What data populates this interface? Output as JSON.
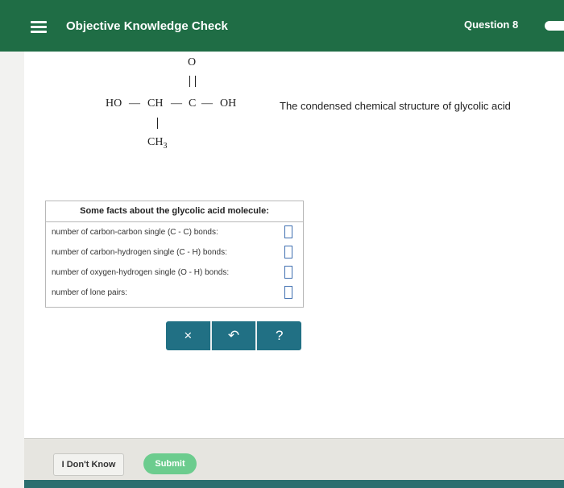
{
  "header": {
    "title": "Objective Knowledge Check",
    "question_label": "Question 8"
  },
  "structure": {
    "o_label": "O",
    "ho_label": "HO",
    "bond_text": "—",
    "ch_label": "CH",
    "c_label": "C",
    "oh_label": "OH",
    "ch3_label": "CH",
    "ch3_sub": "3",
    "caption": "The condensed chemical structure of glycolic acid"
  },
  "facts": {
    "title": "Some facts about the glycolic acid molecule:",
    "rows": [
      {
        "label": "number of carbon-carbon single (C - C) bonds:",
        "value": ""
      },
      {
        "label": "number of carbon-hydrogen single (C - H) bonds:",
        "value": ""
      },
      {
        "label": "number of oxygen-hydrogen single (O - H) bonds:",
        "value": ""
      },
      {
        "label": "number of lone pairs:",
        "value": ""
      }
    ]
  },
  "toolbar": {
    "clear_symbol": "×",
    "undo_symbol": "↶",
    "help_symbol": "?"
  },
  "footer": {
    "dont_know_label": "I Don't Know",
    "submit_label": "Submit"
  },
  "colors": {
    "header_green": "#1f6d45",
    "toolbar_teal": "#217084",
    "submit_green": "#6ccc8e",
    "input_border": "#3f6fb0"
  },
  "icons": {
    "menu": "hamburger-menu-icon",
    "clear": "close-icon",
    "undo": "undo-icon",
    "help": "help-icon"
  }
}
